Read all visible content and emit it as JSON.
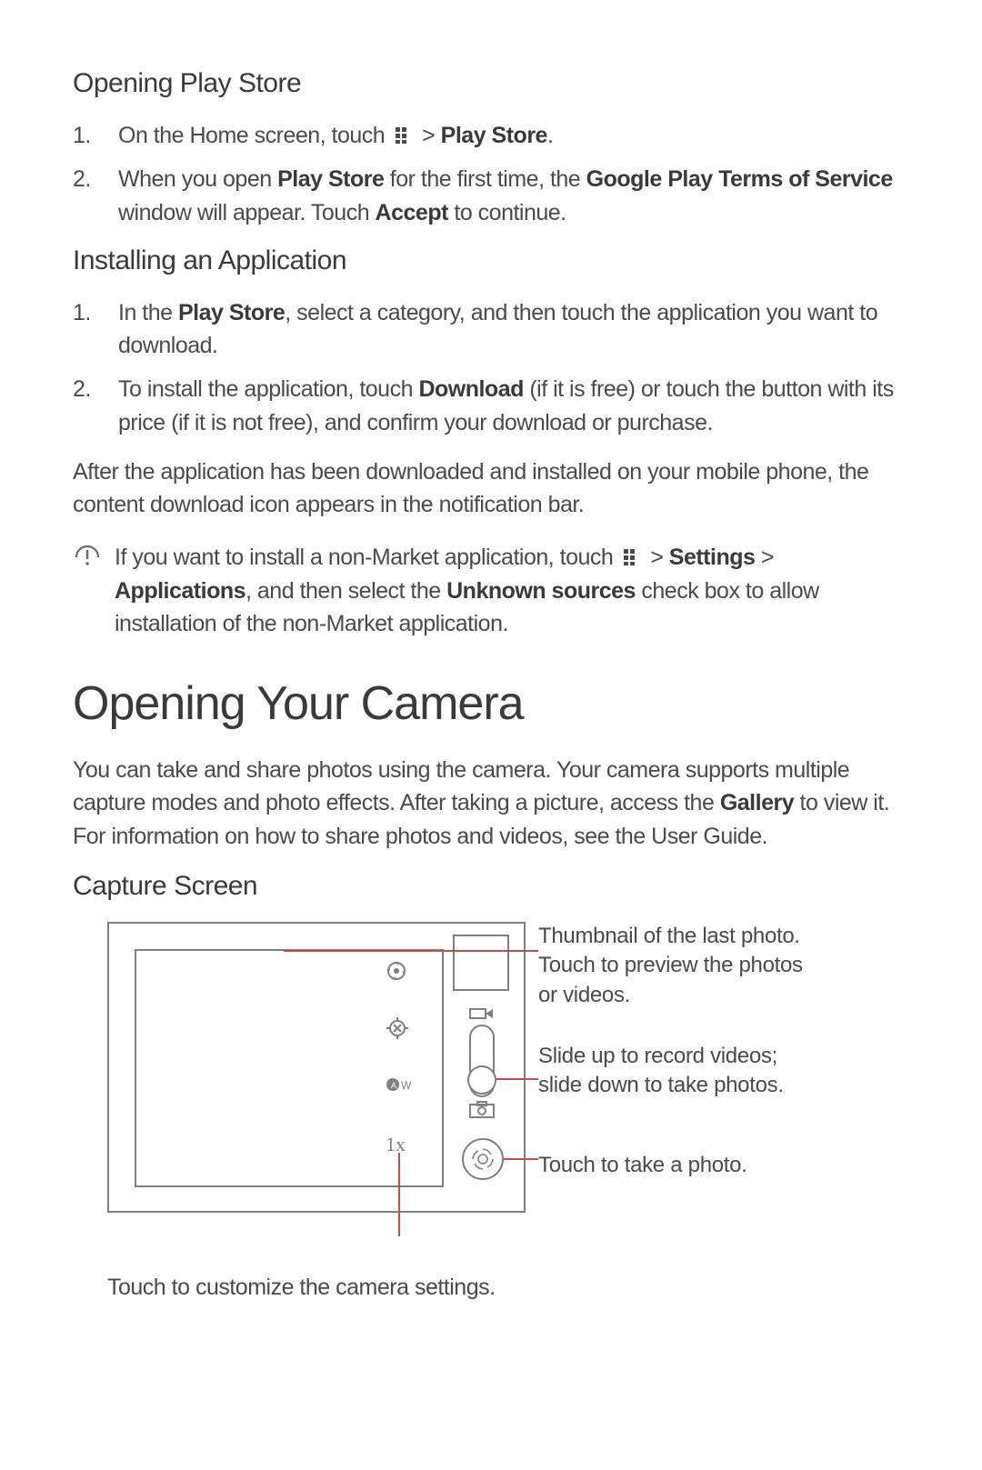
{
  "section1": {
    "heading": "Opening Play Store",
    "items": [
      {
        "num": "1.",
        "pre": "On the Home screen, touch ",
        "post": " > ",
        "bold": "Play Store",
        "tail": "."
      },
      {
        "num": "2.",
        "t1": "When you open ",
        "b1": "Play Store",
        "t2": " for the first time, the ",
        "b2": "Google Play Terms of Service",
        "t3": " window will appear. Touch ",
        "b3": "Accept",
        "t4": " to continue."
      }
    ]
  },
  "section2": {
    "heading": "Installing an Application",
    "items": [
      {
        "num": "1.",
        "t1": "In the ",
        "b1": "Play Store",
        "t2": ", select a category, and then touch the application you want to download."
      },
      {
        "num": "2.",
        "t1": "To install the application, touch ",
        "b1": "Download",
        "t2": " (if it is free) or touch the button with its price (if it is not free), and confirm your download or purchase."
      }
    ],
    "after": "After the application has been downloaded and installed on your mobile phone, the content download icon appears in the notification bar."
  },
  "note": {
    "t1": "If you want to install a non-Market application, touch ",
    "t2": " > ",
    "b1": "Settings",
    "t3": " > ",
    "b2": "Applications",
    "t4": ", and then select the ",
    "b3": "Unknown sources",
    "t5": " check box to allow installation of the non-Market application."
  },
  "camera": {
    "heading": "Opening Your Camera",
    "intro_t1": "You can take and share photos using the camera. Your camera supports multiple capture modes and photo effects. After taking a picture, access the ",
    "intro_b1": "Gallery",
    "intro_t2": " to view it. For information on how to share photos and videos, see the User Guide.",
    "subheading": "Capture Screen",
    "zoom_label": "1x",
    "callout1": "Thumbnail of the last photo. Touch to preview the photos or videos.",
    "callout2": "Slide up to record videos; slide down to take photos.",
    "callout3": "Touch to take a photo.",
    "callout4": "Touch to customize the camera settings."
  }
}
